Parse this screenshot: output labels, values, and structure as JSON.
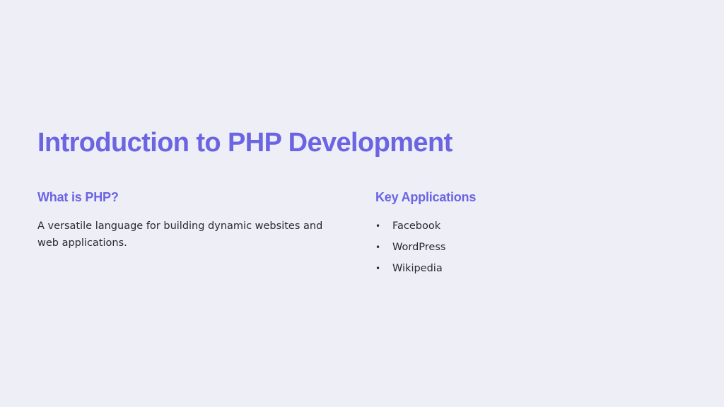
{
  "slide": {
    "title": "Introduction to PHP Development",
    "left_column": {
      "heading": "What is PHP?",
      "text": "A versatile language for building dynamic websites and web applications."
    },
    "right_column": {
      "heading": "Key Applications",
      "bullet_symbol": "•",
      "items": [
        "Facebook",
        "WordPress",
        "Wikipedia"
      ]
    }
  },
  "colors": {
    "background": "#edeef6",
    "accent": "#6b64e3",
    "body_text": "#2a2a30"
  }
}
